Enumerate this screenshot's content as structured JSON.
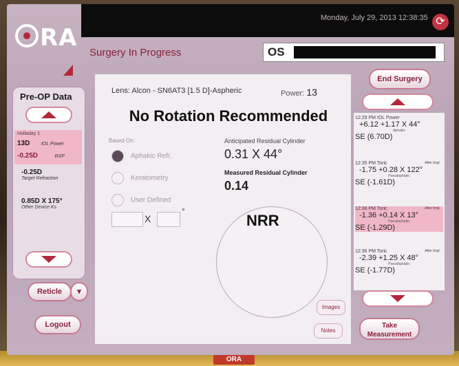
{
  "top": {
    "date": "Monday, July 29, 2013 12:38:35",
    "logo": "ORA"
  },
  "header": {
    "title": "Surgery In Progress",
    "eye": "OS"
  },
  "buttons": {
    "end_surgery": "End Surgery",
    "reticle": "Reticle",
    "logout": "Logout",
    "images": "Images",
    "notes": "Notes",
    "take_measurement": "Take Measurement"
  },
  "left_panel": {
    "title": "Pre-OP Data",
    "formula": "Holladay 1",
    "iol": "13D",
    "iol_label": "IOL Power",
    "rxp": "-0.25D",
    "rxp_label": "RXP",
    "target": "-0.25D",
    "target_label": "Target Refraction",
    "ks": "0.85D X 175°",
    "ks_label": "Other Device Ks"
  },
  "main": {
    "lens": "Lens: Alcon - SN6AT3 [1.5 D]-Aspheric",
    "power_label": "Power:",
    "power_value": "13",
    "recommendation": "No Rotation Recommended",
    "based_on": "Based On:",
    "radio_1": "Aphakic Refr.",
    "radio_2": "Keratometry",
    "radio_3": "User Defined",
    "x": "X",
    "deg": "°",
    "anticipated_label": "Anticipated Residual Cylinder",
    "anticipated_value": "0.31 X 44°",
    "measured_label": "Measured Residual Cylinder",
    "measured_value": "0.14",
    "nrr": "NRR"
  },
  "history": [
    {
      "time": "12:29 PM IOL Power",
      "tag": "",
      "value": "+6.12 +1.17 X 44°",
      "state": "Aphakic",
      "se": "SE (6.70D)"
    },
    {
      "time": "12:35 PM Toric",
      "tag": "After Impl.",
      "value": "-1.75 +0.28 X 122°",
      "state": "Pseudophakic",
      "se": "SE (-1.61D)"
    },
    {
      "time": "12:36 PM Toric",
      "tag": "After Impl.",
      "value": "-1.36 +0.14 X 13°",
      "state": "Pseudophakic",
      "se": "SE (-1.29D)"
    },
    {
      "time": "12:36 PM Toric",
      "tag": "After Impl.",
      "value": "-2.39 +1.25 X 48°",
      "state": "Pseudophakic",
      "se": "SE (-1.77D)"
    }
  ]
}
